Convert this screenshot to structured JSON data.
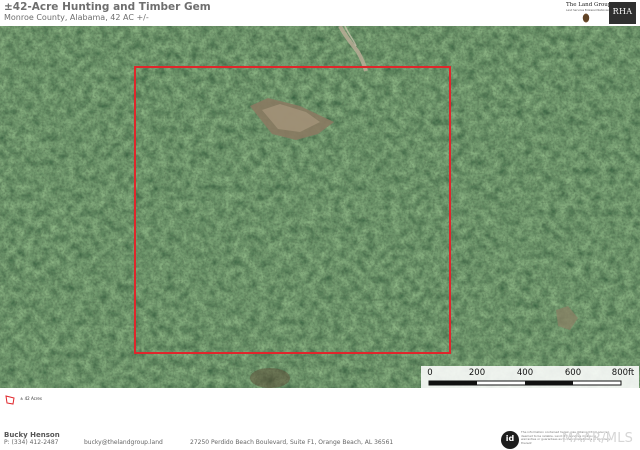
{
  "header": {
    "title": "±42-Acre Hunting and Timber Gem",
    "subtitle": "Monroe County, Alabama, 42 AC +/-"
  },
  "logos": {
    "land_group": {
      "name": "The Land Group",
      "tagline": "Land Services Brokered Nationwide",
      "icon": "pine-cone-icon"
    },
    "rha": {
      "name": "RHA"
    }
  },
  "map": {
    "type": "aerial-satellite",
    "boundary_color": "#e0262b",
    "scale_bar": {
      "ticks": [
        "0",
        "200",
        "400",
        "600",
        "800ft"
      ]
    }
  },
  "legend": {
    "items": [
      {
        "label": "± 42 Acres",
        "color": "#e0262b",
        "icon": "parcel-outline-icon"
      }
    ]
  },
  "footer": {
    "agent_name": "Bucky Henson",
    "phone": "P: (334) 412-2487",
    "email": "bucky@thelandgroup.land",
    "address": "27250 Perdido Beach Boulevard, Suite F1, Orange Beach, AL  36561",
    "id_logo": "id",
    "disclaimer": "The information contained herein was obtained from sources deemed to be reliable. Land id® Services makes no warranties or guarantees as to the completeness or accuracy thereof.",
    "watermark": "MAAR/MLS"
  }
}
